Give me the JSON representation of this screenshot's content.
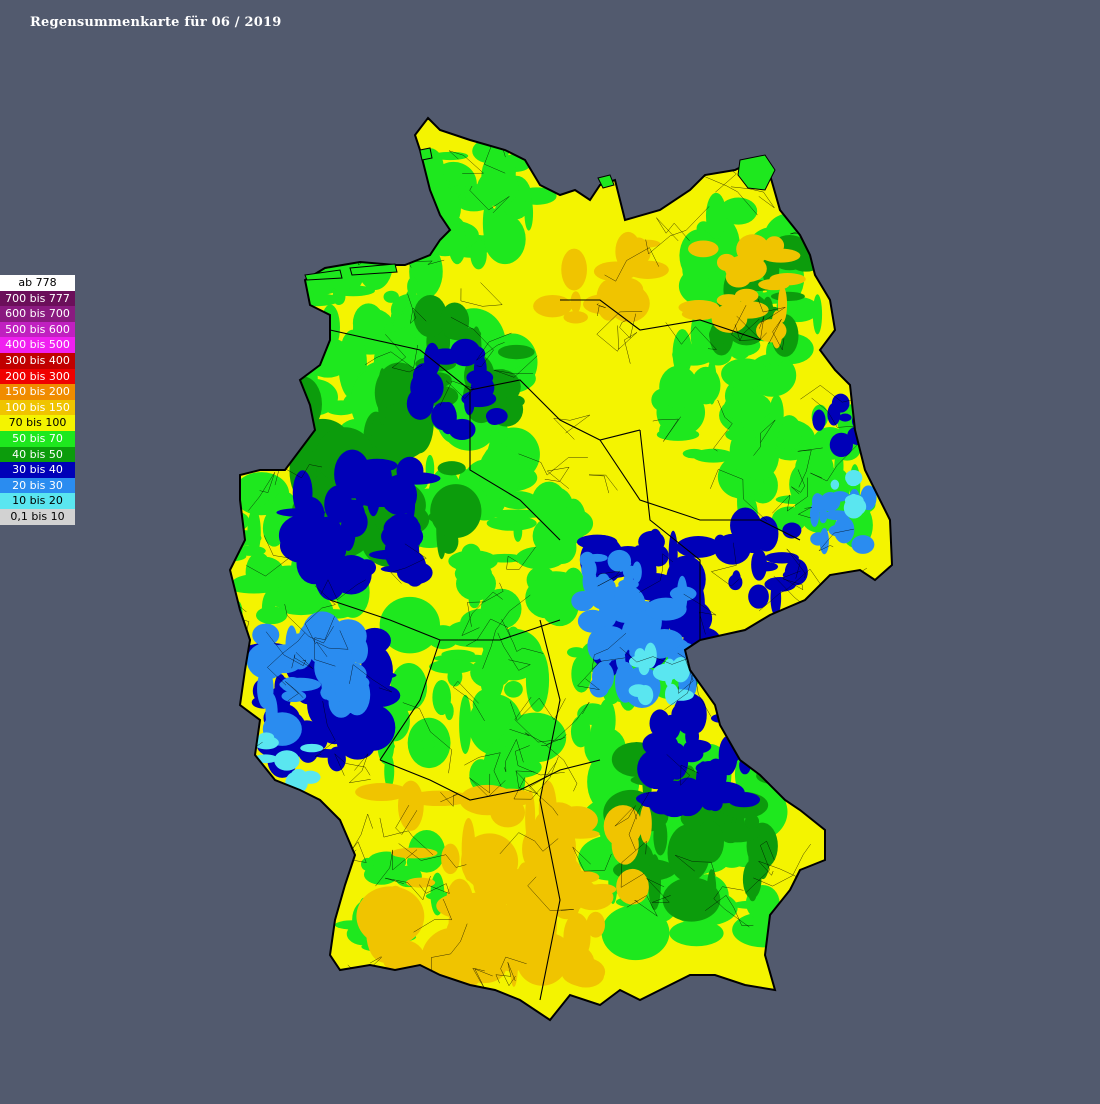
{
  "title": "Regensummenkarte für 06 / 2019",
  "legend": [
    {
      "label": "ab 778",
      "color": "#ffffff"
    },
    {
      "label": "700 bis 777",
      "color": "#6b0f5a"
    },
    {
      "label": "600 bis 700",
      "color": "#8a1a80"
    },
    {
      "label": "500 bis 600",
      "color": "#c020c0"
    },
    {
      "label": "400 bis 500",
      "color": "#f020f0"
    },
    {
      "label": "300 bis 400",
      "color": "#c00000"
    },
    {
      "label": "200 bis 300",
      "color": "#f00000"
    },
    {
      "label": "150 bis 200",
      "color": "#f08c00"
    },
    {
      "label": "100 bis 150",
      "color": "#f0c400"
    },
    {
      "label": "70 bis 100",
      "color": "#f4f400"
    },
    {
      "label": "50 bis 70",
      "color": "#1ee81e"
    },
    {
      "label": "40 bis 50",
      "color": "#0c9c0c"
    },
    {
      "label": "30 bis 40",
      "color": "#0000b8"
    },
    {
      "label": "20 bis 30",
      "color": "#2a8cf0"
    },
    {
      "label": "10 bis 20",
      "color": "#5ae6f0"
    },
    {
      "label": "0,1 bis 10",
      "color": "#d2d2d2"
    }
  ],
  "map": {
    "country": "Germany",
    "background_color": "#525a6e",
    "land_colors": {
      "dry": "#f4f400",
      "very_dry": "#f0c400",
      "moderate": "#1ee81e",
      "moderate_dark": "#0c9c0c",
      "wet": "#0000b8",
      "wetter": "#2a8cf0",
      "wettest": "#5ae6f0"
    }
  }
}
